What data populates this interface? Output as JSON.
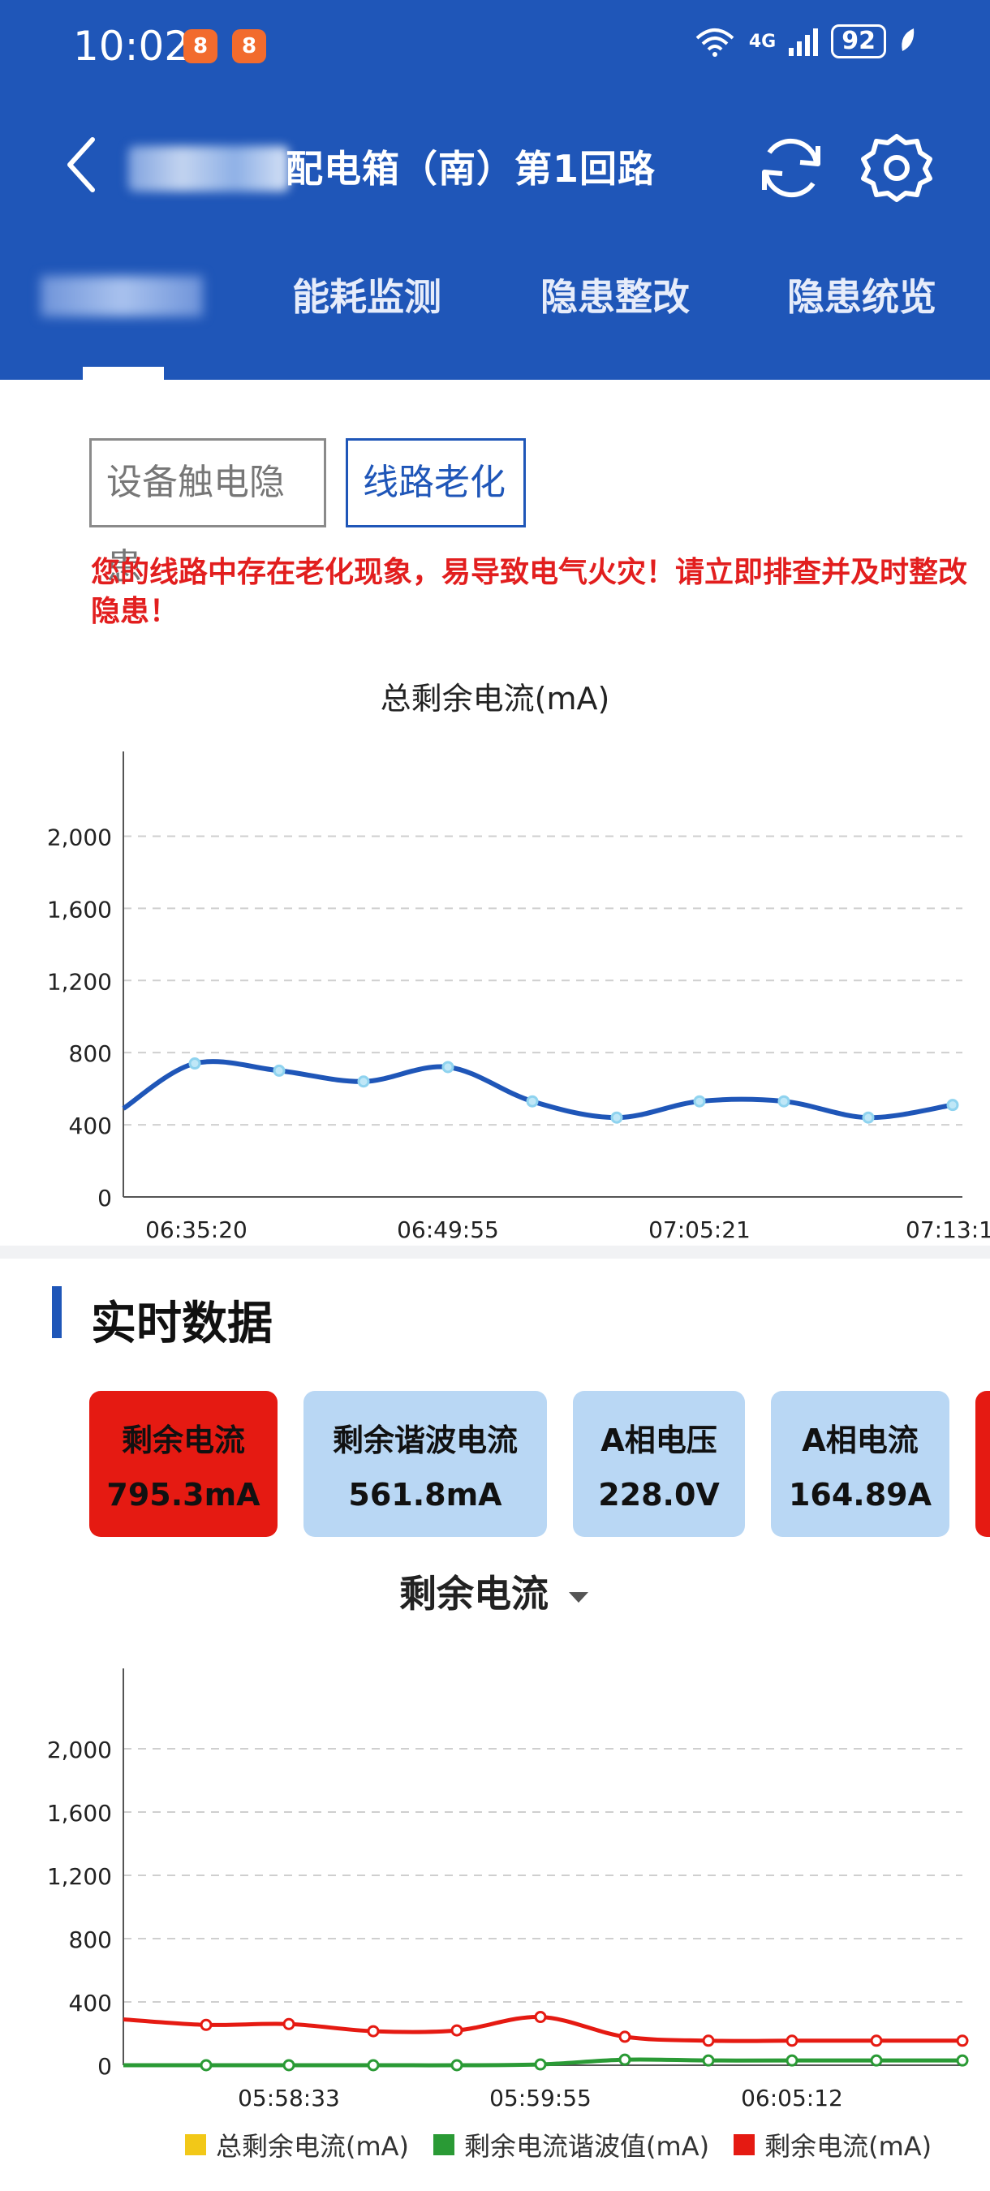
{
  "status": {
    "time": "10:02",
    "network": "4G",
    "battery": "92"
  },
  "header": {
    "title": "配电箱（南）第1回路",
    "tabs": [
      {
        "label": ""
      },
      {
        "label": "能耗监测"
      },
      {
        "label": "隐患整改"
      },
      {
        "label": "隐患统览"
      }
    ]
  },
  "segments": [
    {
      "label": "设备触电隐患",
      "selected": false
    },
    {
      "label": "线路老化",
      "selected": true
    }
  ],
  "warning": "您的线路中存在老化现象，易导致电气火灾！请立即排查并及时整改隐患！",
  "colors": {
    "brand": "#1f56b8",
    "warning": "#e21e1e",
    "active_card": "#e51a12",
    "card": "#b9d7f4"
  },
  "section": {
    "title": "实时数据"
  },
  "cards": [
    {
      "label": "剩余电流",
      "value": "795.3mA",
      "active": true
    },
    {
      "label": "剩余谐波电流",
      "value": "561.8mA",
      "active": false
    },
    {
      "label": "A相电压",
      "value": "228.0V",
      "active": false
    },
    {
      "label": "A相电流",
      "value": "164.89A",
      "active": false
    }
  ],
  "selector": {
    "label": "剩余电流"
  },
  "chart_data": [
    {
      "type": "line",
      "title": "总剩余电流(mA)",
      "ylim": [
        0,
        2200
      ],
      "yticks": [
        0,
        400,
        800,
        1200,
        1600,
        2000
      ],
      "ytick_labels": [
        "0",
        "400",
        "800",
        "1,200",
        "1,600",
        "2,000"
      ],
      "xtick_labels": [
        "06:35:20",
        "06:49:55",
        "07:05:21",
        "07:13:1"
      ],
      "grid": true,
      "series": [
        {
          "color": "#1f56b8",
          "values": [
            490,
            740,
            700,
            640,
            720,
            530,
            440,
            530,
            530,
            440,
            510
          ]
        }
      ]
    },
    {
      "type": "line",
      "ylim": [
        0,
        2200
      ],
      "yticks": [
        0,
        400,
        800,
        1200,
        1600,
        2000
      ],
      "ytick_labels": [
        "0",
        "400",
        "800",
        "1,200",
        "1,600",
        "2,000"
      ],
      "xtick_labels": [
        "05:58:33",
        "05:59:55",
        "06:05:12"
      ],
      "grid": true,
      "legend_position": "bottom",
      "series": [
        {
          "name": "总剩余电流(mA)",
          "color": "#f2c818",
          "values": []
        },
        {
          "name": "剩余电流谐波值(mA)",
          "color": "#2a9a35",
          "values": [
            0,
            0,
            0,
            0,
            0,
            5,
            35,
            30,
            30,
            30,
            30
          ]
        },
        {
          "name": "剩余电流(mA)",
          "color": "#e51a12",
          "values": [
            290,
            255,
            260,
            215,
            220,
            305,
            180,
            155,
            155,
            155,
            155
          ]
        }
      ]
    }
  ]
}
